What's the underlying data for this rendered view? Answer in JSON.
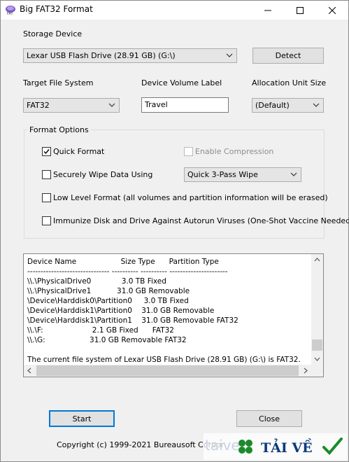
{
  "window": {
    "title": "Big FAT32 Format"
  },
  "title_controls": {
    "minimize": "minimize",
    "maximize": "maximize",
    "close": "close"
  },
  "storage": {
    "label": "Storage Device",
    "selected": "Lexar USB Flash Drive (28.91 GB) (G:\\)",
    "detect_label": "Detect"
  },
  "fs": {
    "label": "Target File System",
    "selected": "FAT32"
  },
  "volume": {
    "label": "Device Volume Label",
    "value": "Travel"
  },
  "alloc": {
    "label": "Allocation Unit Size",
    "selected": "(Default)"
  },
  "options": {
    "title": "Format Options",
    "quick": {
      "label": "Quick Format",
      "checked": true
    },
    "compression": {
      "label": "Enable Compression",
      "checked": false,
      "disabled": true
    },
    "wipe": {
      "label": "Securely Wipe Data Using",
      "checked": false
    },
    "wipe_method": {
      "selected": "Quick 3-Pass Wipe"
    },
    "low_level": {
      "label": "Low Level Format (all volumes and partition information will be erased)",
      "checked": false
    },
    "immunize": {
      "label": "Immunize Disk and Drive Against Autorun Viruses (One-Shot Vaccine Needed)",
      "checked": false
    }
  },
  "log": {
    "lines": [
      "Device Name                   Size Type      Partition Type",
      "------------------------------- ---------- ---------- ----------------------",
      "\\\\.\\PhysicalDrive0             3.0 TB Fixed",
      "\\\\.\\PhysicalDrive1           31.0 GB Removable",
      "\\Device\\Harddisk0\\Partition0     3.0 TB Fixed",
      "\\Device\\Harddisk1\\Partition0    31.0 GB Removable",
      "\\Device\\Harddisk1\\Partition1    31.0 GB Removable FAT32",
      "\\\\.\\F:                     2.1 GB Fixed      FAT32",
      "\\\\.\\G:                   31.0 GB Removable FAT32",
      "",
      "The current file system of Lexar USB Flash Drive (28.91 GB) (G:\\) is FAT32."
    ],
    "text": ""
  },
  "actions": {
    "start_label": "Start",
    "close_label": "Close"
  },
  "footer": {
    "copyright": "Copyright (c) 1999-2021 Bureausoft Corpor"
  },
  "watermark": {
    "text": "TẢI VỀ",
    "site": "taive"
  },
  "colors": {
    "accent": "#0078d7",
    "window_bg": "#f0f0f0",
    "watermark_green": "#1b8a2a",
    "watermark_blue": "#0a3a7a"
  }
}
